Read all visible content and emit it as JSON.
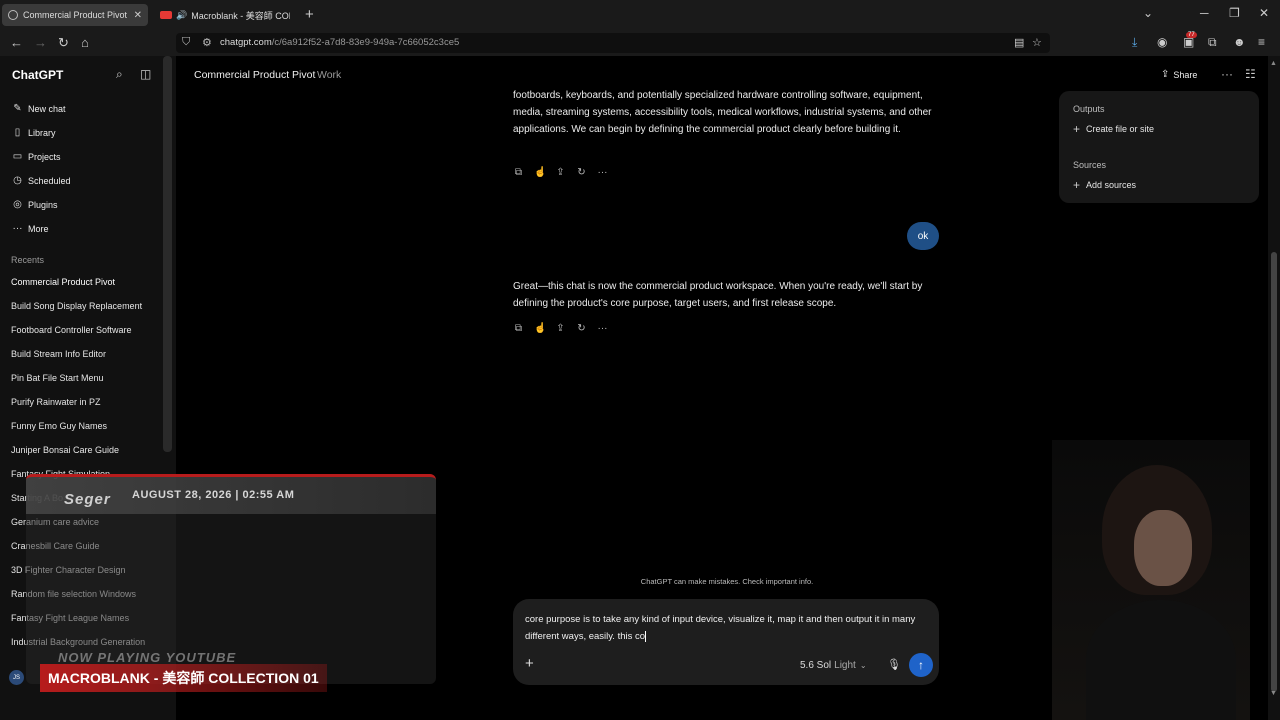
{
  "browser": {
    "tabs": [
      {
        "title": "Commercial Product Pivot",
        "active": true
      },
      {
        "title": "Macroblank - 美容師 COLL",
        "active": false
      }
    ],
    "url_host": "chatgpt.com",
    "url_path": "/c/6a912f52-a7d8-83e9-949a-7c66052c3ce5",
    "extension_badge": "77"
  },
  "sidebar": {
    "brand": "ChatGPT",
    "nav": [
      {
        "label": "New chat",
        "icon": "edit-icon"
      },
      {
        "label": "Library",
        "icon": "library-icon"
      },
      {
        "label": "Projects",
        "icon": "folder-icon"
      },
      {
        "label": "Scheduled",
        "icon": "clock-icon"
      },
      {
        "label": "Plugins",
        "icon": "plugin-icon"
      },
      {
        "label": "More",
        "icon": "more-icon"
      }
    ],
    "recents_label": "Recents",
    "recents": [
      "Commercial Product Pivot",
      "Build Song Display Replacement",
      "Footboard Controller Software",
      "Build Stream Info Editor",
      "Pin Bat File Start Menu",
      "Purify Rainwater in PZ",
      "Funny Emo Guy Names",
      "Juniper Bonsai Care Guide",
      "Fantasy Fight Simulation",
      "Starting A Bo",
      "Geranium care advice",
      "Cranesbill Care Guide",
      "3D Fighter Character Design",
      "Random file selection Windows",
      "Fantasy Fight League Names",
      "Industrial Background Generation"
    ],
    "user_initials": "JS"
  },
  "header": {
    "title": "Commercial Product Pivot",
    "project": "Work",
    "share_label": "Share"
  },
  "conversation": {
    "assistant_1": "footboards, keyboards, and potentially specialized hardware controlling software, equipment, media, streaming systems, accessibility tools, medical workflows, industrial systems, and other applications. We can begin by defining the commercial product clearly before building it.",
    "user_1": "ok",
    "assistant_2": "Great—this chat is now the commercial product workspace. When you're ready, we'll start by defining the product's core purpose, target users, and first release scope."
  },
  "side_panel": {
    "outputs_label": "Outputs",
    "outputs_action": "Create file or site",
    "sources_label": "Sources",
    "sources_action": "Add sources"
  },
  "composer": {
    "disclaimer": "ChatGPT can make mistakes. Check important info.",
    "input_text": "core purpose is to take any kind of input device, visualize it, map it and then output it in many different ways, easily. this co",
    "model_name": "5.6 Sol",
    "model_mode": "Light"
  },
  "overlay": {
    "logo": "Seger",
    "datetime": "AUGUST 28, 2026 | 02:55 AM",
    "now_playing": "NOW PLAYING YOUTUBE",
    "song": "MACROBLANK - 美容師 COLLECTION 01"
  }
}
